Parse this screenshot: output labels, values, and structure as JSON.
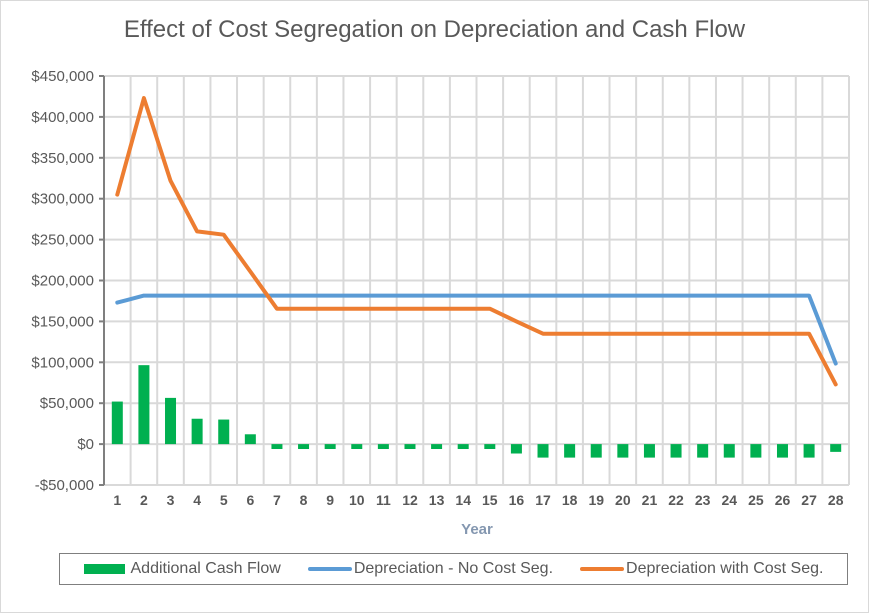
{
  "chart_data": {
    "type": "bar+line",
    "title": "Effect of Cost Segregation on Depreciation and Cash Flow",
    "xlabel": "Year",
    "ylabel": "",
    "ylim": [
      -50000,
      450000
    ],
    "ytick_step": 50000,
    "yticks": [
      "-$50,000",
      "$0",
      "$50,000",
      "$100,000",
      "$150,000",
      "$200,000",
      "$250,000",
      "$300,000",
      "$350,000",
      "$400,000",
      "$450,000"
    ],
    "grid": true,
    "legend_position": "bottom",
    "categories": [
      "1",
      "2",
      "3",
      "4",
      "5",
      "6",
      "7",
      "8",
      "9",
      "10",
      "11",
      "12",
      "13",
      "14",
      "15",
      "16",
      "17",
      "18",
      "19",
      "20",
      "21",
      "22",
      "23",
      "24",
      "25",
      "26",
      "27",
      "28"
    ],
    "series": [
      {
        "name": "Additional Cash Flow",
        "type": "bar",
        "color": "#00b050",
        "values": [
          52000,
          96500,
          56500,
          31000,
          30000,
          12000,
          -6000,
          -6000,
          -6000,
          -6000,
          -6000,
          -6000,
          -6000,
          -6000,
          -6000,
          -11500,
          -16500,
          -16500,
          -16500,
          -16500,
          -16500,
          -16500,
          -16500,
          -16500,
          -16500,
          -16500,
          -16500,
          -9500
        ]
      },
      {
        "name": "Depreciation - No Cost Seg.",
        "type": "line",
        "color": "#5b9bd5",
        "values": [
          173000,
          181500,
          181500,
          181500,
          181500,
          181500,
          181500,
          181500,
          181500,
          181500,
          181500,
          181500,
          181500,
          181500,
          181500,
          181500,
          181500,
          181500,
          181500,
          181500,
          181500,
          181500,
          181500,
          181500,
          181500,
          181500,
          181500,
          98500
        ]
      },
      {
        "name": "Depreciation with Cost Seg.",
        "type": "line",
        "color": "#ed7d31",
        "values": [
          305000,
          423000,
          322000,
          260000,
          256000,
          211000,
          165500,
          165500,
          165500,
          165500,
          165500,
          165500,
          165500,
          165500,
          165500,
          150000,
          135000,
          135000,
          135000,
          135000,
          135000,
          135000,
          135000,
          135000,
          135000,
          135000,
          135000,
          73000
        ]
      }
    ]
  }
}
